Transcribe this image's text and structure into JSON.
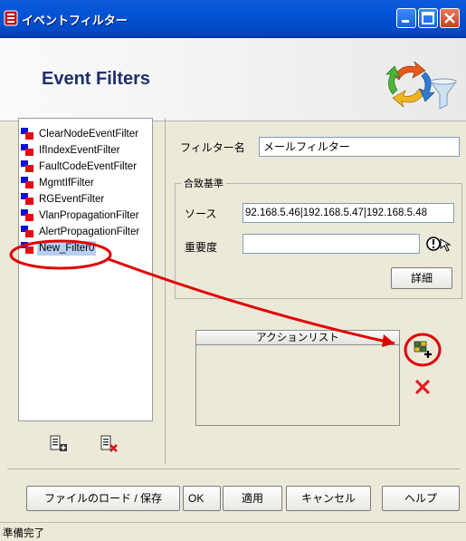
{
  "window": {
    "title": "イベントフィルター",
    "icon": "app-icon",
    "controls": [
      "minimize-icon",
      "maximize-icon",
      "close-icon"
    ]
  },
  "header": {
    "title": "Event Filters",
    "logo": "event-filter-funnel-logo"
  },
  "filters": {
    "items": [
      {
        "label": "ClearNodeEventFilter",
        "icon": "filter-item-icon"
      },
      {
        "label": "IfIndexEventFilter",
        "icon": "filter-item-icon"
      },
      {
        "label": "FaultCodeEventFilter",
        "icon": "filter-item-icon"
      },
      {
        "label": "MgmtIfFilter",
        "icon": "filter-item-icon"
      },
      {
        "label": "RGEventFilter",
        "icon": "filter-item-icon"
      },
      {
        "label": "VlanPropagationFilter",
        "icon": "filter-item-icon"
      },
      {
        "label": "AlertPropagationFilter",
        "icon": "filter-item-icon"
      },
      {
        "label": "New_Filter0",
        "icon": "filter-item-icon",
        "selected": true
      }
    ],
    "add_icon": "add-filter-icon",
    "delete_icon": "delete-filter-icon"
  },
  "form": {
    "filter_name_label": "フィルター名",
    "filter_name_value": "メールフィルター",
    "criteria_title": "合致基準",
    "source_label": "ソース",
    "source_value": "92.168.5.46|192.168.5.47|192.168.5.48",
    "severity_label": "重要度",
    "severity_value": "",
    "severity_picker_icon": "severity-picker-icon",
    "details_button": "詳細"
  },
  "actions": {
    "header": "アクションリスト",
    "add_icon": "add-action-icon",
    "remove_icon": "remove-action-icon"
  },
  "buttons": {
    "load_save": "ファイルのロード / 保存",
    "ok": "OK",
    "apply": "適用",
    "cancel": "キャンセル",
    "help": "ヘルプ"
  },
  "status": {
    "text": "準備完了"
  },
  "annotation": {
    "color": "#e00000"
  }
}
